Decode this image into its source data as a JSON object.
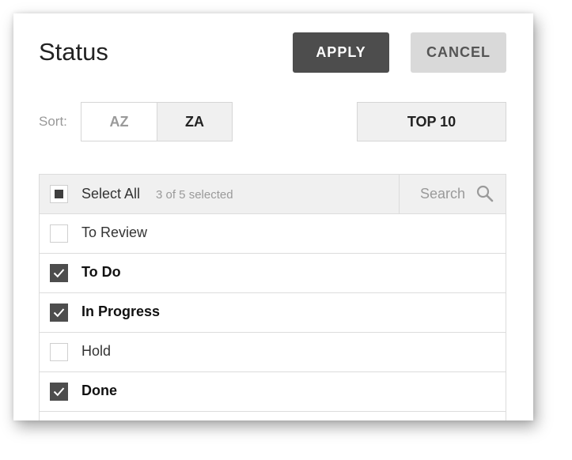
{
  "header": {
    "title": "Status",
    "apply_label": "APPLY",
    "cancel_label": "CANCEL"
  },
  "sort": {
    "label": "Sort:",
    "az_label": "AZ",
    "za_label": "ZA",
    "active": "ZA",
    "top_label": "TOP 10"
  },
  "list": {
    "select_all_label": "Select All",
    "selection_summary": "3 of 5 selected",
    "search_placeholder": "Search",
    "items": [
      {
        "label": "To Review",
        "checked": false
      },
      {
        "label": "To Do",
        "checked": true
      },
      {
        "label": "In Progress",
        "checked": true
      },
      {
        "label": "Hold",
        "checked": false
      },
      {
        "label": "Done",
        "checked": true
      }
    ]
  },
  "colors": {
    "primary_button": "#4d4d4d",
    "secondary_button": "#d9d9d9",
    "checkbox_checked": "#4d4d4d",
    "header_bg": "#f0f0f0"
  }
}
